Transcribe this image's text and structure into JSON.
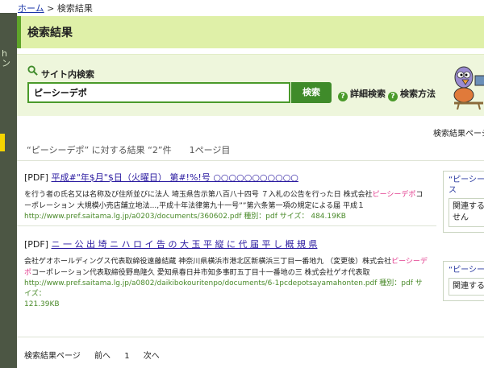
{
  "left_strip": {
    "text": "hン"
  },
  "breadcrumb": {
    "home": "ホーム",
    "separator": ">",
    "current": "検索結果"
  },
  "header": {
    "title": "検索結果"
  },
  "search": {
    "label": "サイト内検索",
    "value": "ピーシーデポ",
    "button": "検索",
    "advanced_link": "詳細検索",
    "howto_link": "検索方法"
  },
  "results_per_page_label": "検索結果ページ",
  "summary": {
    "query_text": "“ピーシーデポ” に対する結果 “2”件",
    "page_text": "1ページ目"
  },
  "results": [
    {
      "type": "[PDF]",
      "title": "平成#\"年$月\"$日（火曜日） 第#!%!号 ○○○○○○○○○○○",
      "snippet_before": "を行う者の氏名又は名称及び住所並びに法人 埼玉県告示第八百八十四号 ７入札の公告を行った日 株式会社",
      "snippet_highlight": "ピーシーデポ",
      "snippet_after": "コーポレーション 大規模小売店舗立地法...,平成十年法律第九十一号””第六条第一項の規定による届 平成１",
      "url": "http://www.pref.saitama.lg.jp/a0203/documents/360602.pdf",
      "kind_label": "種別：pdf サイズ：",
      "size": "484.19KB"
    },
    {
      "type": "[PDF]",
      "title": "ニ 一 公 出 埼 ニ ハ ロ イ 告 の 大 玉 平 縦 に 代 届 平 し 概 規 県",
      "snippet_before": "会社ゲオホールディングス代表取締役遠藤結蔵 神奈川県横浜市港北区新横浜三丁目一番地九 （変更後）株式会社",
      "snippet_highlight": "ピーシーデポ",
      "snippet_after": "コーポレーション代表取締役野島隆久 愛知県春日井市知多事町五丁目十一番地の三 株式会社ゲオ代表取",
      "url": "http://www.pref.saitama.lg.jp/a0802/daikibokouritenpo/documents/6-1pcdepotsayamahonten.pdf",
      "kind_label": "種別：pdf サイズ：",
      "size": "121.39KB"
    }
  ],
  "side_boxes": [
    {
      "title": "“ピーシーデ",
      "title2": "ス",
      "inner1": "関連する",
      "inner2": "せん"
    },
    {
      "title": "“ピーシーデ",
      "inner1": "関連する"
    }
  ],
  "pager": {
    "label": "検索結果ページ",
    "prev": "前へ",
    "current": "1",
    "next": "次へ"
  },
  "colors": {
    "accent_green": "#3f8b2a",
    "header_bg": "#dff0a8",
    "panel_bg": "#eef6dc",
    "highlight": "#e23b8d",
    "link": "#2a1aa0"
  },
  "icons": [
    "search-icon",
    "question-icon",
    "question-icon",
    "mascot-bird-icon"
  ]
}
